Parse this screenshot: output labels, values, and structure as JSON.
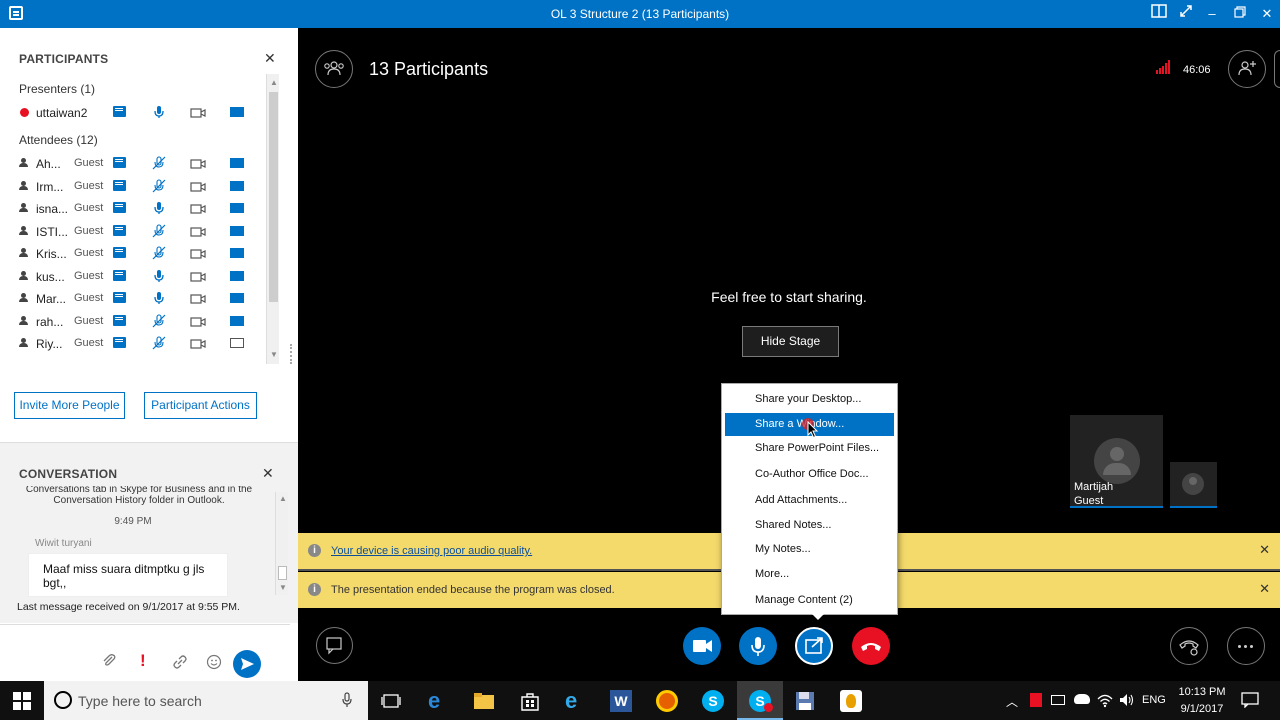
{
  "window": {
    "title": "OL 3 Structure 2 (13 Participants)"
  },
  "participants_panel": {
    "title": "PARTICIPANTS",
    "presenters_label": "Presenters (1)",
    "attendees_label": "Attendees (12)",
    "presenters": [
      {
        "name": "uttaiwan2",
        "role": ""
      }
    ],
    "attendees": [
      {
        "name": "Ah...",
        "role": "Guest"
      },
      {
        "name": "Irm...",
        "role": "Guest"
      },
      {
        "name": "isna...",
        "role": "Guest"
      },
      {
        "name": "ISTI...",
        "role": "Guest"
      },
      {
        "name": "Kris...",
        "role": "Guest"
      },
      {
        "name": "kus...",
        "role": "Guest"
      },
      {
        "name": "Mar...",
        "role": "Guest"
      },
      {
        "name": "rah...",
        "role": "Guest"
      },
      {
        "name": "Riy...",
        "role": "Guest"
      }
    ],
    "invite_button": "Invite More People",
    "actions_button": "Participant Actions"
  },
  "conversation": {
    "title": "CONVERSATION",
    "history_text": "Conversations tab in Skype for Business and in the Conversation History folder in Outlook.",
    "history_time": "9:49 PM",
    "sender": "Wiwit turyani",
    "message": "Maaf miss suara ditmptku g jls bgt,,",
    "last_received": "Last message received on 9/1/2017 at 9:55 PM."
  },
  "stage": {
    "participants_title": "13 Participants",
    "timer": "46:06",
    "share_prompt": "Feel free to start sharing.",
    "hide_stage_button": "Hide Stage",
    "video_tile_name": "Martijah",
    "video_tile_role": "Guest"
  },
  "banners": {
    "audio_warning": "Your device is causing poor audio quality.",
    "presentation_ended": "The presentation ended because the program was closed."
  },
  "share_menu": {
    "items": [
      "Share your Desktop...",
      "Share a Window...",
      "Share PowerPoint Files...",
      "Co-Author Office Doc...",
      "Add Attachments...",
      "Shared Notes...",
      "My Notes...",
      "More...",
      "Manage Content (2)"
    ]
  },
  "taskbar": {
    "search_placeholder": "Type here to search",
    "language": "ENG",
    "time": "10:13 PM",
    "date": "9/1/2017"
  },
  "colors": {
    "accent": "#0072c6",
    "hangup": "#e81123",
    "banner": "#f4d96b"
  }
}
